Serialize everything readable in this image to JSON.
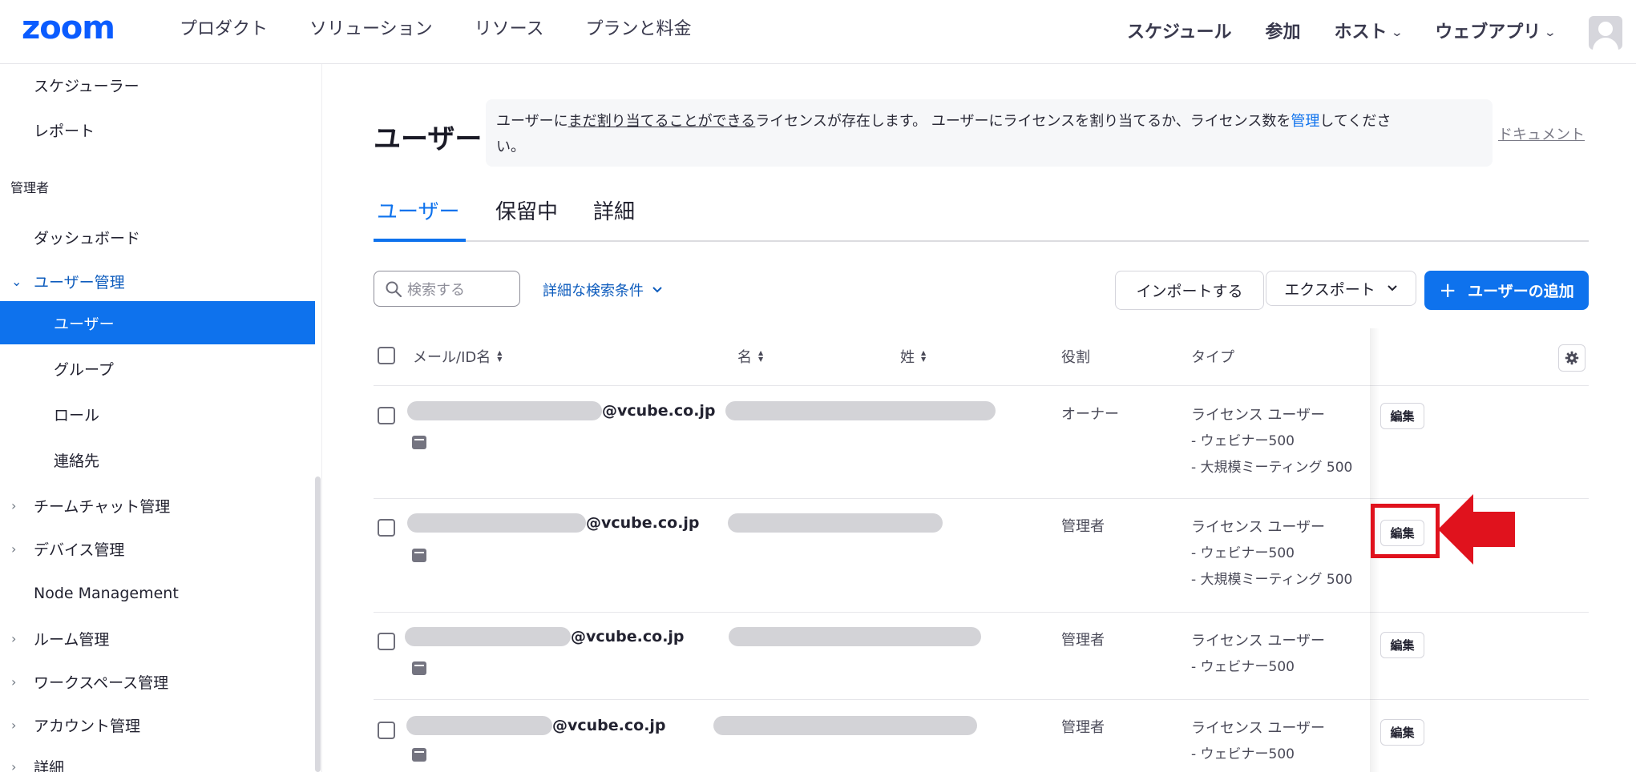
{
  "brand": {
    "logo_text": "zoom",
    "accent": "#0e72ed",
    "highlight": "#e0121d"
  },
  "topnav": {
    "left": [
      "プロダクト",
      "ソリューション",
      "リソース",
      "プランと料金"
    ],
    "right": [
      {
        "label": "スケジュール",
        "dropdown": false
      },
      {
        "label": "参加",
        "dropdown": false
      },
      {
        "label": "ホスト",
        "dropdown": true
      },
      {
        "label": "ウェブアプリ",
        "dropdown": true
      }
    ]
  },
  "sidebar": {
    "top_items": [
      "スケジューラー",
      "レポート"
    ],
    "section_label": "管理者",
    "dashboard": "ダッシュボード",
    "user_mgmt": "ユーザー管理",
    "user_mgmt_children": [
      "ユーザー",
      "グループ",
      "ロール",
      "連絡先"
    ],
    "collapsed": [
      "チームチャット管理",
      "デバイス管理"
    ],
    "node": "Node Management",
    "more": [
      "ルーム管理",
      "ワークスペース管理",
      "アカウント管理",
      "詳細"
    ]
  },
  "page": {
    "title": "ユーザー",
    "notice": {
      "part1": "ユーザーに",
      "underlined": "まだ割り当てることができる",
      "part2": "ライセンスが存在します。 ユーザーにライセンスを割り当てるか、ライセンス数を",
      "link": "管理",
      "part3": "してくださ",
      "part4": "い。"
    },
    "doc_link": "ドキュメント",
    "tabs": [
      "ユーザー",
      "保留中",
      "詳細"
    ],
    "search_placeholder": "検索する",
    "advanced_search": "詳細な検索条件",
    "import_label": "インポートする",
    "export_label": "エクスポート",
    "add_user_label": "ユーザーの追加",
    "add_user_icon": "+"
  },
  "table": {
    "headers": {
      "email": "メール/ID名",
      "first": "名",
      "last": "姓",
      "role": "役割",
      "type": "タイプ"
    },
    "edit_label": "編集",
    "rows": [
      {
        "domain": "@vcube.co.jp",
        "role": "オーナー",
        "type": "ライセンス ユーザー",
        "licenses": [
          "- ウェビナー500",
          "- 大規模ミーティング 500"
        ]
      },
      {
        "domain": "@vcube.co.jp",
        "role": "管理者",
        "type": "ライセンス ユーザー",
        "licenses": [
          "- ウェビナー500",
          "- 大規模ミーティング 500"
        ]
      },
      {
        "domain": "@vcube.co.jp",
        "role": "管理者",
        "type": "ライセンス ユーザー",
        "licenses": [
          "- ウェビナー500"
        ]
      },
      {
        "domain": "@vcube.co.jp",
        "role": "管理者",
        "type": "ライセンス ユーザー",
        "licenses": [
          "- ウェビナー500"
        ]
      }
    ]
  }
}
